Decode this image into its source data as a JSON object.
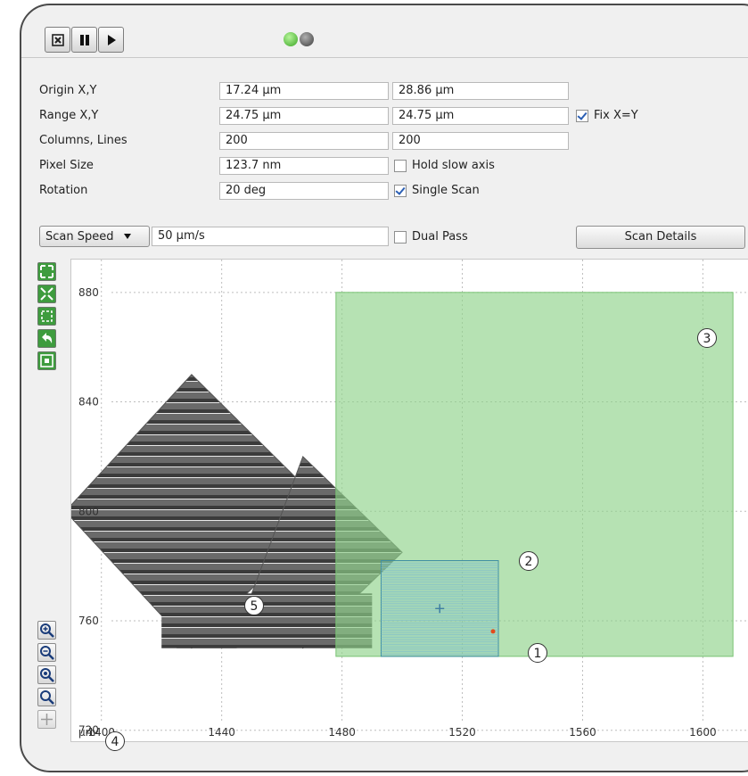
{
  "toolbar": {
    "stop_icon": "stop-x-icon",
    "pause_icon": "pause-icon",
    "play_icon": "play-icon",
    "status_colors": {
      "active": "#5cc43a",
      "inactive": "#5a5a5a"
    }
  },
  "params": {
    "origin": {
      "label": "Origin X,Y",
      "x": "17.24 µm",
      "y": "28.86 µm"
    },
    "range": {
      "label": "Range X,Y",
      "x": "24.75 µm",
      "y": "24.75 µm"
    },
    "fix_xy": {
      "label": "Fix X=Y",
      "checked": true
    },
    "columns_lines": {
      "label": "Columns, Lines",
      "x": "200",
      "y": "200"
    },
    "pixel_size": {
      "label": "Pixel Size",
      "value": "123.7 nm"
    },
    "hold_slow_axis": {
      "label": "Hold slow axis",
      "checked": false
    },
    "rotation": {
      "label": "Rotation",
      "value": "20 deg"
    },
    "single_scan": {
      "label": "Single Scan",
      "checked": true
    },
    "scan_speed": {
      "selected": "Scan Speed",
      "value": "50 µm/s"
    },
    "dual_pass": {
      "label": "Dual Pass",
      "checked": false
    },
    "scan_details_button": "Scan Details"
  },
  "side_toolbar": [
    "zoom-extents-icon",
    "fit-icon",
    "fit-selection-icon",
    "undo-icon",
    "center-icon",
    "zoom-in-icon",
    "zoom-out-icon",
    "zoom-region-icon",
    "zoom-icon",
    "crosshair-icon"
  ],
  "plot": {
    "unit_label": "µm",
    "x_ticks": [
      "1400",
      "1440",
      "1480",
      "1520",
      "1560",
      "1600"
    ],
    "y_ticks": [
      "720",
      "760",
      "800",
      "840",
      "880"
    ],
    "x_range": [
      1390,
      1615
    ],
    "y_range": [
      716,
      892
    ],
    "colors": {
      "scan_area": "#8fd28a",
      "selection": "#6bb3c4",
      "grid": "#bdbdbd"
    },
    "callouts": [
      "1",
      "2",
      "3",
      "4",
      "5"
    ]
  }
}
